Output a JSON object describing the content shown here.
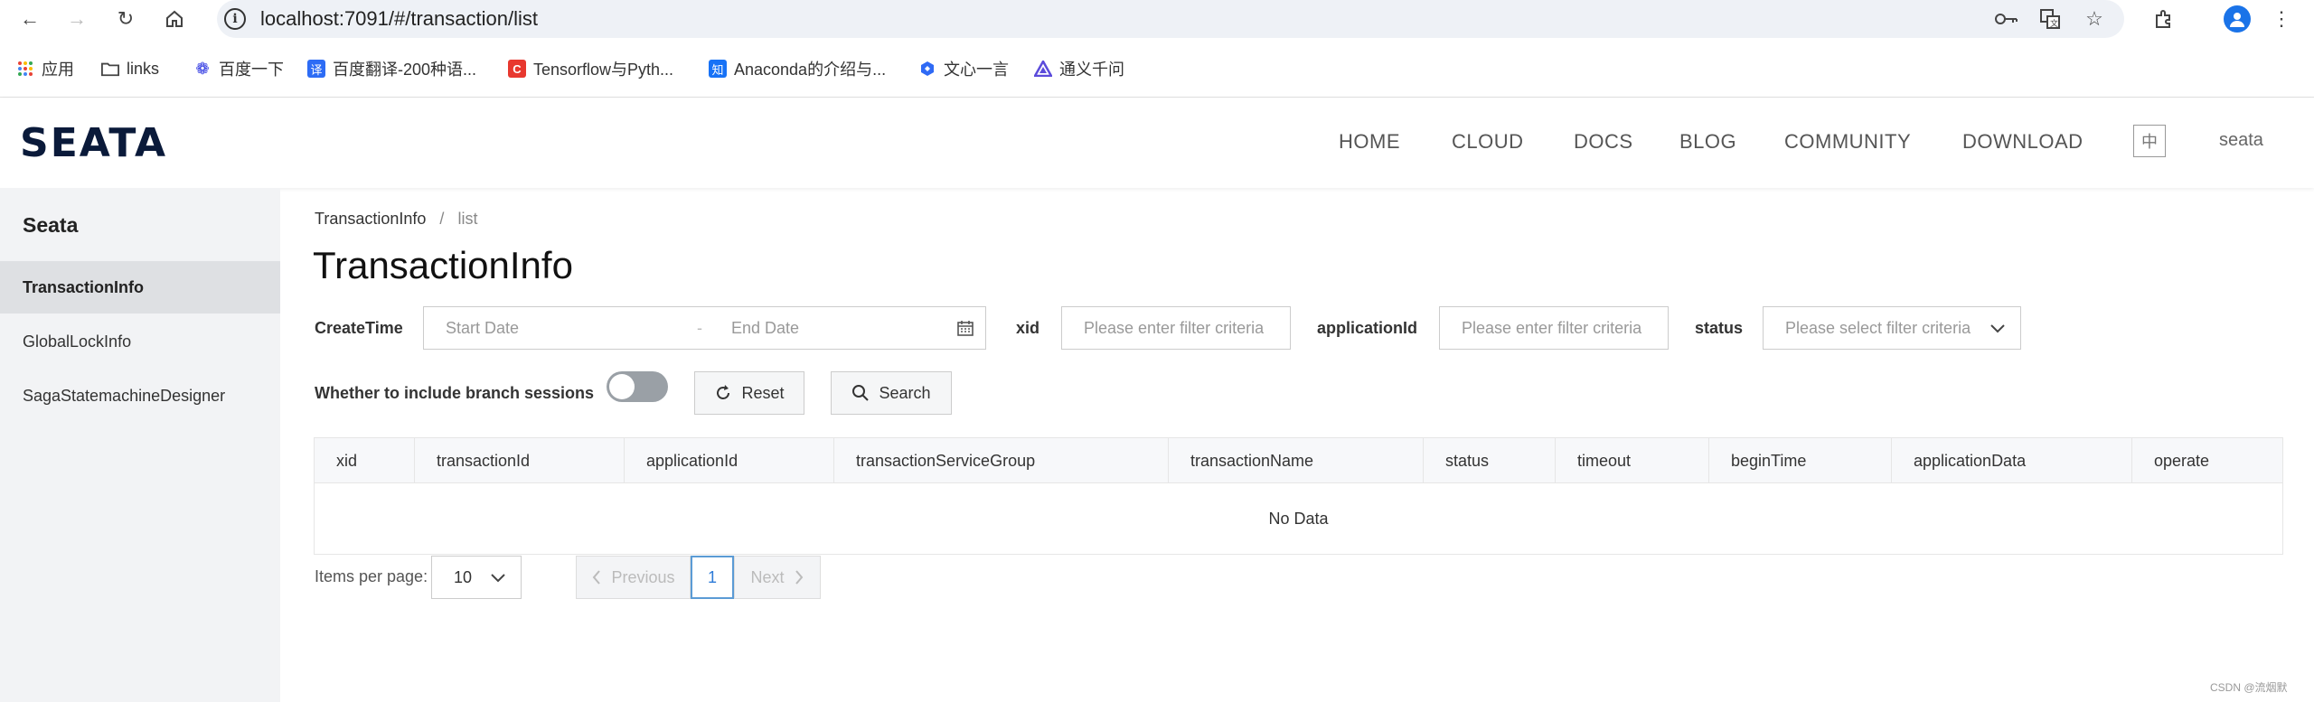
{
  "browser": {
    "url": "localhost:7091/#/transaction/list",
    "bookmarks": [
      {
        "label": "应用",
        "icon": "apps-grid-icon",
        "color": "#e94235"
      },
      {
        "label": "links",
        "icon": "folder-icon",
        "color": "#444444"
      },
      {
        "label": "百度一下",
        "icon": "baidu-paw-icon",
        "color": "#2932e1"
      },
      {
        "label": "百度翻译-200种语...",
        "icon": "baidu-translate-icon",
        "color": "#2d6cf5"
      },
      {
        "label": "Tensorflow与Pyth...",
        "icon": "csdn-c-icon",
        "color": "#e8382f"
      },
      {
        "label": "Anaconda的介绍与...",
        "icon": "zhihu-icon",
        "color": "#1772f6"
      },
      {
        "label": "文心一言",
        "icon": "wenxin-icon",
        "color": "#2f6af5"
      },
      {
        "label": "通义千问",
        "icon": "tongyi-icon",
        "color": "#5b4bdb"
      }
    ]
  },
  "header": {
    "logo": "SEATA",
    "nav": [
      "HOME",
      "CLOUD",
      "DOCS",
      "BLOG",
      "COMMUNITY",
      "DOWNLOAD"
    ],
    "lang_toggle": "中",
    "user": "seata"
  },
  "sidebar": {
    "title": "Seata",
    "items": [
      {
        "label": "TransactionInfo",
        "active": true
      },
      {
        "label": "GlobalLockInfo",
        "active": false
      },
      {
        "label": "SagaStatemachineDesigner",
        "active": false
      }
    ]
  },
  "main": {
    "breadcrumb": [
      "TransactionInfo",
      "list"
    ],
    "breadcrumb_sep": "/",
    "title": "TransactionInfo",
    "filters": {
      "createtime_label": "CreateTime",
      "start_placeholder": "Start Date",
      "date_sep": "-",
      "end_placeholder": "End Date",
      "xid_label": "xid",
      "xid_placeholder": "Please enter filter criteria",
      "appid_label": "applicationId",
      "appid_placeholder": "Please enter filter criteria",
      "status_label": "status",
      "status_placeholder": "Please select filter criteria",
      "branch_label": "Whether to include branch sessions",
      "branch_enabled": false,
      "reset_label": "Reset",
      "search_label": "Search"
    },
    "table": {
      "columns": [
        "xid",
        "transactionId",
        "applicationId",
        "transactionServiceGroup",
        "transactionName",
        "status",
        "timeout",
        "beginTime",
        "applicationData",
        "operate"
      ],
      "rows": [],
      "empty_text": "No Data"
    },
    "pagination": {
      "items_per_page_label": "Items per page:",
      "page_size": "10",
      "previous_label": "Previous",
      "current_page": "1",
      "next_label": "Next"
    }
  },
  "footer": {
    "watermark": "CSDN @流烟默"
  }
}
